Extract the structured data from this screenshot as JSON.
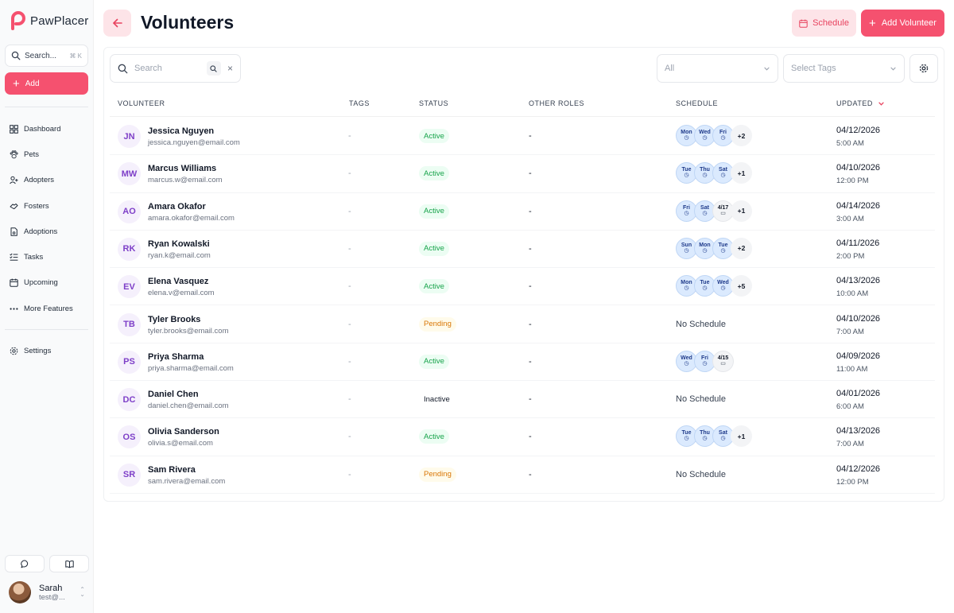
{
  "app": {
    "name": "PawPlacer",
    "brand_color": "#f5516f"
  },
  "sidebar": {
    "search_label": "Search...",
    "search_shortcut": "⌘ K",
    "add_label": "Add",
    "items": [
      {
        "label": "Dashboard",
        "icon": "dashboard-icon"
      },
      {
        "label": "Pets",
        "icon": "paw-icon"
      },
      {
        "label": "Adopters",
        "icon": "user-plus-icon"
      },
      {
        "label": "Fosters",
        "icon": "handshake-icon"
      },
      {
        "label": "Adoptions",
        "icon": "document-paw-icon"
      },
      {
        "label": "Tasks",
        "icon": "list-check-icon"
      },
      {
        "label": "Upcoming",
        "icon": "calendar-icon"
      },
      {
        "label": "More Features",
        "icon": "more-dots-icon"
      }
    ],
    "settings_label": "Settings",
    "user": {
      "name": "Sarah",
      "email": "test@..."
    }
  },
  "header": {
    "title": "Volunteers",
    "schedule_label": "Schedule",
    "add_volunteer_label": "Add Volunteer"
  },
  "filters": {
    "search_placeholder": "Search",
    "status_select": "All",
    "tags_select": "Select Tags"
  },
  "table": {
    "columns": {
      "volunteer": "VOLUNTEER",
      "tags": "TAGS",
      "status": "STATUS",
      "other_roles": "OTHER ROLES",
      "schedule": "SCHEDULE",
      "updated": "UPDATED"
    },
    "rows": [
      {
        "initials": "JN",
        "name": "Jessica Nguyen",
        "email": "jessica.nguyen@email.com",
        "tags": "-",
        "status": "Active",
        "roles": "-",
        "schedule": [
          {
            "t": "day",
            "v": "Mon"
          },
          {
            "t": "day",
            "v": "Wed"
          },
          {
            "t": "day",
            "v": "Fri"
          },
          {
            "t": "more",
            "v": "+2"
          }
        ],
        "date": "04/12/2026",
        "time": "5:00 AM"
      },
      {
        "initials": "MW",
        "name": "Marcus Williams",
        "email": "marcus.w@email.com",
        "tags": "-",
        "status": "Active",
        "roles": "-",
        "schedule": [
          {
            "t": "day",
            "v": "Tue"
          },
          {
            "t": "day",
            "v": "Thu"
          },
          {
            "t": "day",
            "v": "Sat"
          },
          {
            "t": "more",
            "v": "+1"
          }
        ],
        "date": "04/10/2026",
        "time": "12:00 PM"
      },
      {
        "initials": "AO",
        "name": "Amara Okafor",
        "email": "amara.okafor@email.com",
        "tags": "-",
        "status": "Active",
        "roles": "-",
        "schedule": [
          {
            "t": "day",
            "v": "Fri"
          },
          {
            "t": "day",
            "v": "Sat"
          },
          {
            "t": "date",
            "v": "4/17"
          },
          {
            "t": "more",
            "v": "+1"
          }
        ],
        "date": "04/14/2026",
        "time": "3:00 AM"
      },
      {
        "initials": "RK",
        "name": "Ryan Kowalski",
        "email": "ryan.k@email.com",
        "tags": "-",
        "status": "Active",
        "roles": "-",
        "schedule": [
          {
            "t": "day",
            "v": "Sun"
          },
          {
            "t": "day",
            "v": "Mon"
          },
          {
            "t": "day",
            "v": "Tue"
          },
          {
            "t": "more",
            "v": "+2"
          }
        ],
        "date": "04/11/2026",
        "time": "2:00 PM"
      },
      {
        "initials": "EV",
        "name": "Elena Vasquez",
        "email": "elena.v@email.com",
        "tags": "-",
        "status": "Active",
        "roles": "-",
        "schedule": [
          {
            "t": "day",
            "v": "Mon"
          },
          {
            "t": "day",
            "v": "Tue"
          },
          {
            "t": "day",
            "v": "Wed"
          },
          {
            "t": "more",
            "v": "+5"
          }
        ],
        "date": "04/13/2026",
        "time": "10:00 AM"
      },
      {
        "initials": "TB",
        "name": "Tyler Brooks",
        "email": "tyler.brooks@email.com",
        "tags": "-",
        "status": "Pending",
        "roles": "-",
        "schedule_text": "No Schedule",
        "date": "04/10/2026",
        "time": "7:00 AM"
      },
      {
        "initials": "PS",
        "name": "Priya Sharma",
        "email": "priya.sharma@email.com",
        "tags": "-",
        "status": "Active",
        "roles": "-",
        "schedule": [
          {
            "t": "day",
            "v": "Wed"
          },
          {
            "t": "day",
            "v": "Fri"
          },
          {
            "t": "date",
            "v": "4/15"
          }
        ],
        "date": "04/09/2026",
        "time": "11:00 AM"
      },
      {
        "initials": "DC",
        "name": "Daniel Chen",
        "email": "daniel.chen@email.com",
        "tags": "-",
        "status": "Inactive",
        "roles": "-",
        "schedule_text": "No Schedule",
        "date": "04/01/2026",
        "time": "6:00 AM"
      },
      {
        "initials": "OS",
        "name": "Olivia Sanderson",
        "email": "olivia.s@email.com",
        "tags": "-",
        "status": "Active",
        "roles": "-",
        "schedule": [
          {
            "t": "day",
            "v": "Tue"
          },
          {
            "t": "day",
            "v": "Thu"
          },
          {
            "t": "day",
            "v": "Sat"
          },
          {
            "t": "more",
            "v": "+1"
          }
        ],
        "date": "04/13/2026",
        "time": "7:00 AM"
      },
      {
        "initials": "SR",
        "name": "Sam Rivera",
        "email": "sam.rivera@email.com",
        "tags": "-",
        "status": "Pending",
        "roles": "-",
        "schedule_text": "No Schedule",
        "date": "04/12/2026",
        "time": "12:00 PM"
      }
    ]
  }
}
